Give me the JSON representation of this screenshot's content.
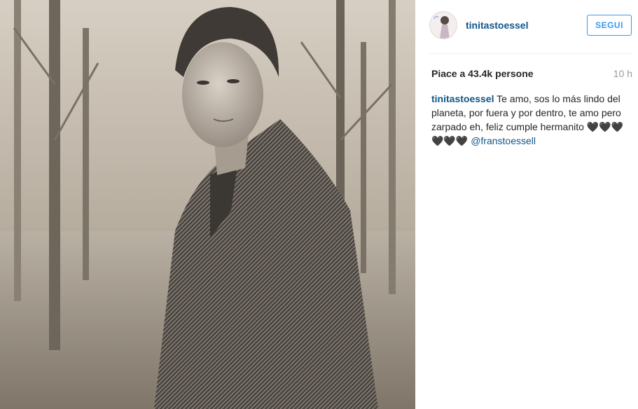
{
  "post": {
    "username": "tinitastoessel",
    "follow_label": "SEGUI",
    "likes_text": "Piace a 43.4k persone",
    "time_ago": "10 h",
    "caption_author": "tinitastoessel",
    "caption_text": " Te amo, sos lo más lindo del planeta, por fuera y por dentro, te amo pero zarpado eh, feliz cumple hermanito 🖤🖤🖤🖤🖤🖤 ",
    "caption_mention": "@franstoessell"
  },
  "colors": {
    "link": "#125688",
    "button": "#3897f0",
    "muted": "#999999"
  },
  "icons": {
    "avatar": "profile-avatar"
  }
}
